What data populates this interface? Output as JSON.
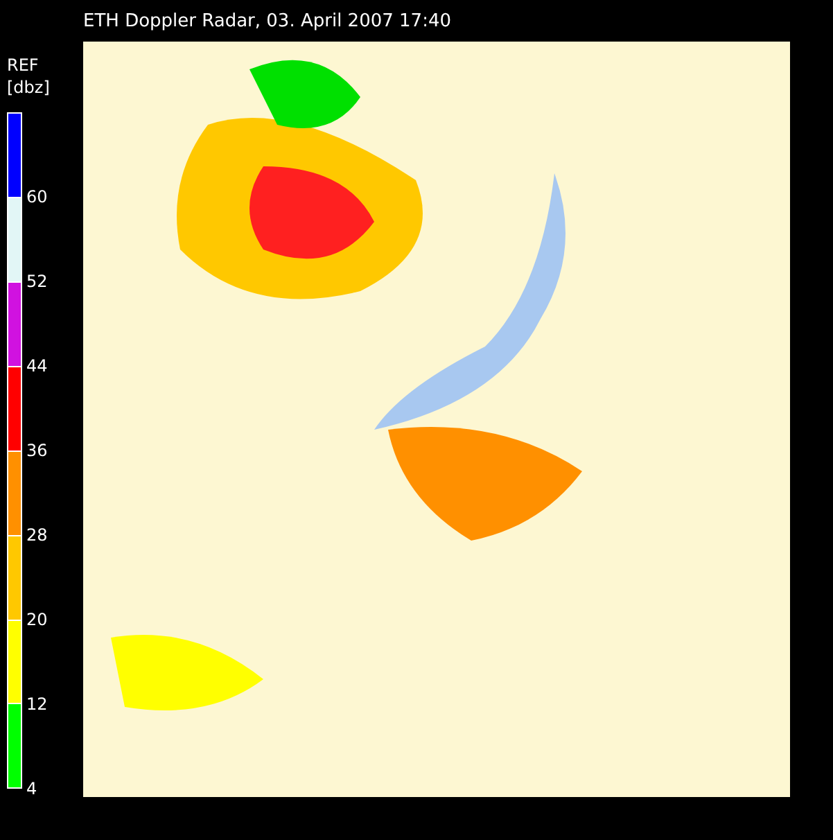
{
  "title": "ETH Doppler Radar, 03. April 2007 17:40",
  "legend": {
    "quantity": "REF",
    "unit": "[dbz]",
    "bands": [
      {
        "color": "#0000ff",
        "label": "60"
      },
      {
        "color": "#e2f6f6",
        "label": "52"
      },
      {
        "color": "#d012e0",
        "label": "44"
      },
      {
        "color": "#ff0000",
        "label": "36"
      },
      {
        "color": "#ff9000",
        "label": "28"
      },
      {
        "color": "#ffc800",
        "label": "20"
      },
      {
        "color": "#ffff00",
        "label": "12"
      },
      {
        "color": "#00ff00",
        "label": "4"
      }
    ]
  }
}
